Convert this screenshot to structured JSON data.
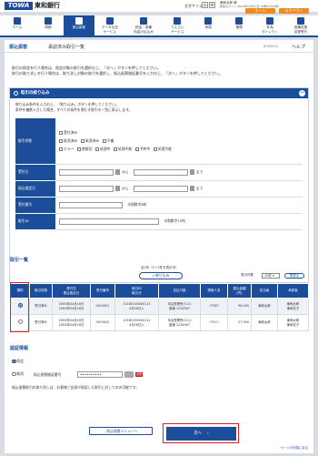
{
  "header": {
    "logo": "TOWA",
    "bank_name": "東和銀行",
    "font_size_label": "文字サイズ",
    "font_sizes": [
      "小",
      "中",
      "大"
    ],
    "user": "東和太郎 様",
    "last_login": "前回ログイン 20XX年04月16日 10時05分30秒",
    "home_button": "ホーム",
    "logout_button": "ログアウト"
  },
  "nav": [
    {
      "label": "ホーム"
    },
    {
      "label": "明細"
    },
    {
      "label": "振込振替"
    },
    {
      "label": "データ伝送\nサービス"
    },
    {
      "label": "税金・各種\n料金の払込み"
    },
    {
      "label": "でんさい\nサービス"
    },
    {
      "label": "承認"
    },
    {
      "label": "管理"
    },
    {
      "label": "外為\nダイレクト"
    },
    {
      "label": "各種変更\n変更受付"
    }
  ],
  "page": {
    "section": "振込振替",
    "title": "承認済み取引一覧",
    "code": "BTZ0004",
    "help": "ヘルプ"
  },
  "intro": [
    "取引の照会を行う場合は、照会対象の取引を選択の上、「次へ」ボタンを押してください。",
    "取引の取り消しを行う場合は、取り消し対象の取引を選択し、振込振替暗証番号を入力の上、「次へ」ボタンを押してください。"
  ],
  "filter": {
    "heading": "取引の絞り込み",
    "toggle": "−",
    "desc": [
      "絞り込み条件を入力の上、「絞り込み」ボタンを押してください。",
      "条件を複数入力した場合、すべての条件を満たす取引を一覧に表示します。"
    ],
    "status_label": "取引状態",
    "status_options": [
      "受付済み",
      "取消済み",
      "取消済み",
      "不備",
      "エラー",
      "期限切",
      "処理中",
      "処理不能",
      "予約中",
      "処理不能"
    ],
    "accept_date_label": "受付日",
    "transfer_date_label": "振込指定日",
    "from_label": "から",
    "to_label": "まで",
    "trans_no_label": "受付番号",
    "trans_no_hint": "半角数字8桁",
    "trans_id_label": "取引ID",
    "trans_id_hint": "半角数字15桁",
    "button": "絞り込み"
  },
  "list": {
    "heading": "取引一覧",
    "count_text": "全2件（1〜2件を表示中）",
    "per_page_label": "表示件数",
    "per_page_value": "10件",
    "redisplay": "再表示",
    "columns": [
      "選択",
      "取引状態",
      "受付日\n振込指定日",
      "受付番号",
      "取引ID\n取引日",
      "支払口座",
      "受取人名",
      "振込金額\n(円)",
      "担当者",
      "承認者"
    ],
    "rows": [
      [
        "受付済み",
        "20XX年04月16日\n20XX年04月16日",
        "0415001",
        "10180100000111\n4月16日入",
        "本店営業所(111)\n普通 1234567",
        "ﾄｳﾜﾀﾛｳ",
        "98,000",
        "東和太郎",
        "東和太郎\n東和花子"
      ],
      [
        "受付済み",
        "20XX年04月16日\n20XX年04月16日",
        "0415002",
        "10180100000112\n4月16日入",
        "本店営業所(111)\n普通 1234567",
        "ﾄｳﾜﾊﾅｺ",
        "27,000",
        "東和太郎",
        "東和太郎\n東和花子"
      ]
    ]
  },
  "auth": {
    "heading": "認証情報",
    "option_view": "照会",
    "option_cancel": "取消",
    "pw_label": "振込振替暗証番号",
    "pw_value": "••••••••••",
    "required": "必須",
    "note": "振込振替取引の取り消しは、お客様ご自身が承認した取引に対してのみ可能です。"
  },
  "buttons": {
    "back": "振込振替メニューへ",
    "next": "次へ",
    "pagetop": "ページの先頭に戻る"
  }
}
